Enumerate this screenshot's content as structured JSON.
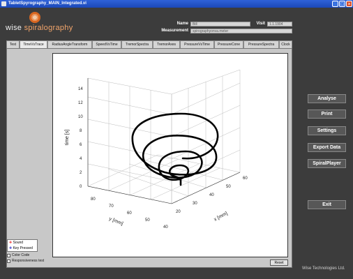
{
  "window": {
    "title": "TabletSpyrography_MAIN_Integrated.vi"
  },
  "logo": {
    "word1": "wise",
    "word2": "spiralography"
  },
  "header": {
    "name_label": "Name",
    "name_value": "Bill",
    "visit_label": "Visit",
    "visit_value": "1.1.1904",
    "measurement_label": "Measurement",
    "measurement_value": "spirographyonva.meter"
  },
  "tabs": [
    "Test",
    "TimeVsTrace",
    "RadiusAngleTransform",
    "SpeedVsTime",
    "TremorSpectra",
    "TremorAxes",
    "PressureVsTime",
    "PressureCone",
    "PressureSpectra",
    "Clock"
  ],
  "active_tab": "TimeVsTrace",
  "legend": {
    "items": [
      "Sound",
      "Key Pressed"
    ]
  },
  "checkboxes": [
    "Color Code",
    "Responsiveness test"
  ],
  "reset_label": "Reset",
  "side_buttons": {
    "analyse": "Analyse",
    "print": "Print",
    "settings": "Settings",
    "export": "Export Data",
    "spiralplayer": "SpiralPlayer",
    "exit": "Exit"
  },
  "credit": "Wise Technologies Ltd.",
  "chart_data": {
    "type": "line",
    "projection": "3d",
    "xlabel": "x [mm]",
    "ylabel": "y [mm]",
    "zlabel": "time [s]",
    "x_ticks": [
      "20",
      "30",
      "40",
      "50",
      "60"
    ],
    "y_ticks": [
      "80",
      "70",
      "60",
      "50",
      "40"
    ],
    "z_ticks": [
      "0",
      "2",
      "4",
      "6",
      "8",
      "10",
      "12",
      "14"
    ],
    "xlim": [
      20,
      70
    ],
    "ylim": [
      30,
      80
    ],
    "zlim": [
      0,
      15
    ],
    "grid": true,
    "series_color": "#000000"
  }
}
